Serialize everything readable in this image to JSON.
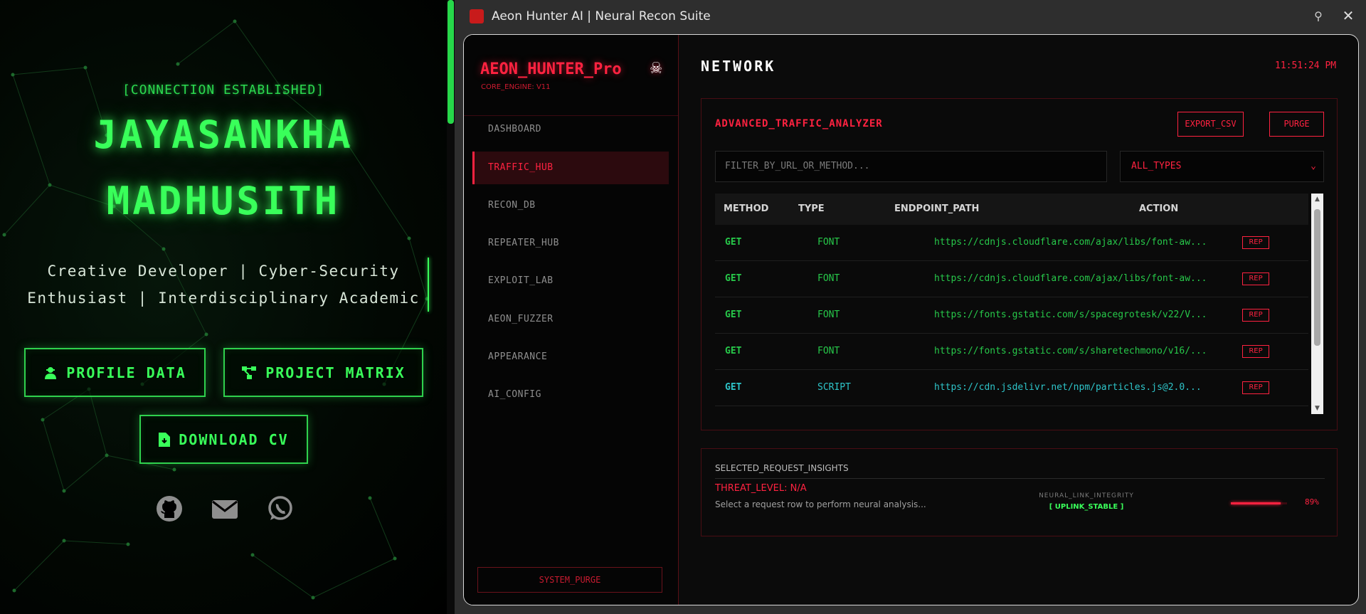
{
  "portfolio": {
    "status_line": "[CONNECTION ESTABLISHED]",
    "name_line1": "JAYASANKHA",
    "name_line2": "MADHUSITH",
    "tagline_line1": "Creative Developer | Cyber-Security",
    "tagline_line2": "Enthusiast | Interdisciplinary Academic",
    "buttons": {
      "profile": "PROFILE DATA",
      "project": "PROJECT MATRIX",
      "cv": "DOWNLOAD CV"
    },
    "socials": [
      "github-icon",
      "mail-icon",
      "whatsapp-icon"
    ],
    "accent_color": "#39ff5a"
  },
  "window": {
    "title": "Aeon Hunter AI | Neural Recon Suite",
    "pin_glyph": "⚲",
    "close_glyph": "✕"
  },
  "sidebar": {
    "logo": "AEON_HUNTER_Pro",
    "logo_glyph": "☠",
    "core_engine": "CORE_ENGINE: V11",
    "items": [
      {
        "label": "DASHBOARD",
        "active": false
      },
      {
        "label": "TRAFFIC_HUB",
        "active": true
      },
      {
        "label": "RECON_DB",
        "active": false
      },
      {
        "label": "REPEATER_HUB",
        "active": false
      },
      {
        "label": "EXPLOIT_LAB",
        "active": false
      },
      {
        "label": "AEON_FUZZER",
        "active": false
      },
      {
        "label": "APPEARANCE",
        "active": false
      },
      {
        "label": "AI_CONFIG",
        "active": false
      }
    ],
    "system_purge": "SYSTEM_PURGE"
  },
  "main": {
    "section_title": "NETWORK",
    "clock": "11:51:24 PM",
    "analyzer": {
      "title": "ADVANCED_TRAFFIC_ANALYZER",
      "export_label": "EXPORT_CSV",
      "purge_label": "PURGE",
      "filter_placeholder": "FILTER_BY_URL_OR_METHOD...",
      "type_select": "ALL_TYPES",
      "columns": [
        "METHOD",
        "TYPE",
        "ENDPOINT_PATH",
        "ACTION"
      ],
      "rows": [
        {
          "method": "GET",
          "type": "FONT",
          "path": "https://cdnjs.cloudflare.com/ajax/libs/font-aw...",
          "action": "REP",
          "color": "#27c94a"
        },
        {
          "method": "GET",
          "type": "FONT",
          "path": "https://cdnjs.cloudflare.com/ajax/libs/font-aw...",
          "action": "REP",
          "color": "#27c94a"
        },
        {
          "method": "GET",
          "type": "FONT",
          "path": "https://fonts.gstatic.com/s/spacegrotesk/v22/V...",
          "action": "REP",
          "color": "#27c94a"
        },
        {
          "method": "GET",
          "type": "FONT",
          "path": "https://fonts.gstatic.com/s/sharetechmono/v16/...",
          "action": "REP",
          "color": "#27c94a"
        },
        {
          "method": "GET",
          "type": "SCRIPT",
          "path": "https://cdn.jsdelivr.net/npm/particles.js@2.0...",
          "action": "REP",
          "color": "#2ec4c9"
        }
      ]
    },
    "insights": {
      "title": "SELECTED_REQUEST_INSIGHTS",
      "threat_level": "THREAT_LEVEL: N/A",
      "hint": "Select a request row to perform neural analysis...",
      "integrity_label": "NEURAL_LINK_INTEGRITY",
      "integrity_status": "[ UPLINK_STABLE ]",
      "integrity_percent_label": "89%",
      "integrity_fraction": 0.89
    }
  },
  "colors": {
    "alert_red": "#ff2240",
    "dark_bg": "#0b0b0b"
  }
}
